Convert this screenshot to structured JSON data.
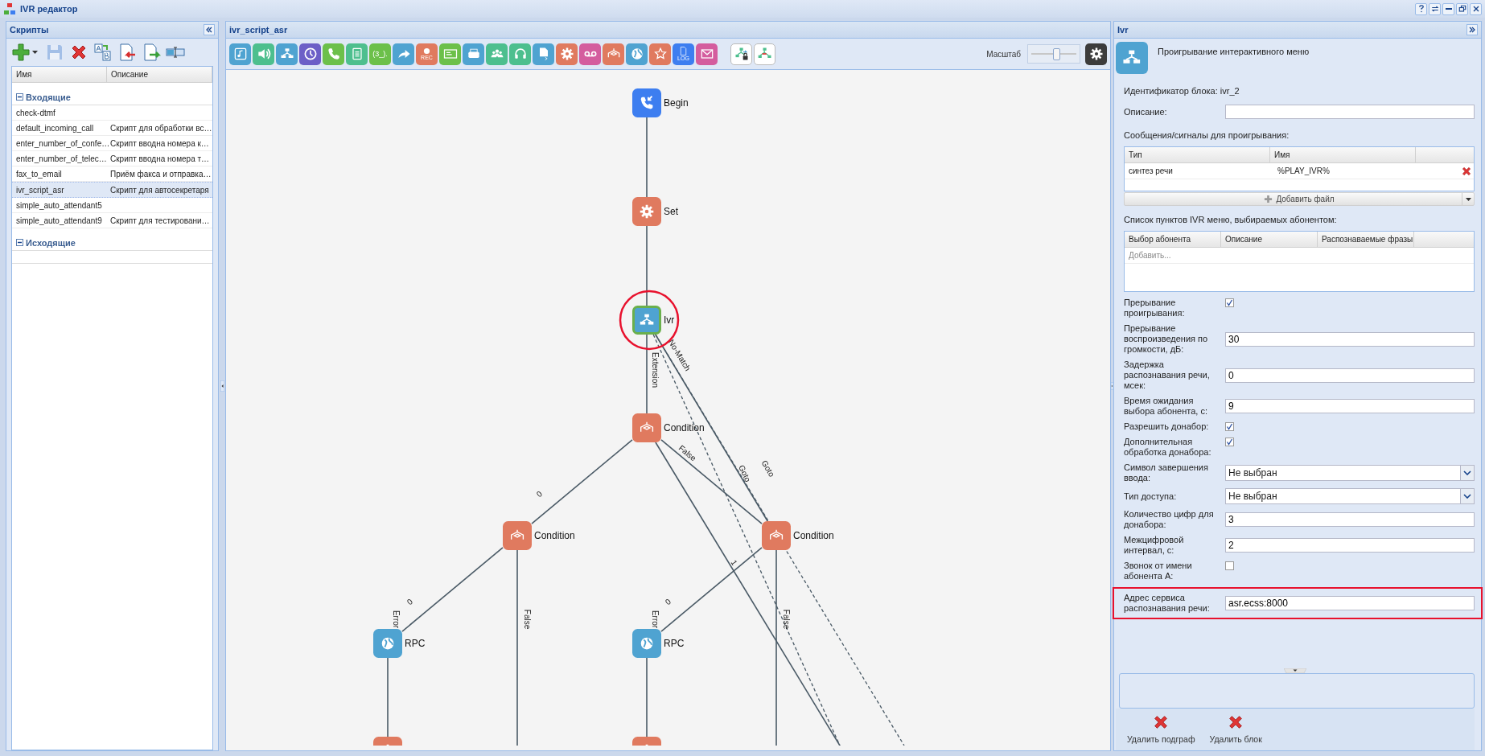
{
  "window": {
    "title": "IVR редактор",
    "controls": [
      {
        "kind": "help"
      },
      {
        "kind": "refresh"
      },
      {
        "kind": "minimize"
      },
      {
        "kind": "restore"
      },
      {
        "kind": "close"
      }
    ]
  },
  "scripts_panel": {
    "title": "Скрипты",
    "toolbar": [
      {
        "kind": "add",
        "disabled": false
      },
      {
        "kind": "save",
        "disabled": true
      },
      {
        "kind": "delete",
        "disabled": false
      },
      {
        "kind": "rename",
        "disabled": false
      },
      {
        "kind": "import",
        "disabled": false
      },
      {
        "kind": "export",
        "disabled": false
      },
      {
        "kind": "split",
        "disabled": false
      }
    ],
    "columns": [
      "Имя",
      "Описание"
    ],
    "groups": [
      {
        "label": "Входящие",
        "expanded": true,
        "rows": [
          {
            "name": "check-dtmf",
            "selected": false
          },
          {
            "name": "default_incoming_call",
            "description": "Скрипт для обработки вс…",
            "selected": false
          },
          {
            "name": "enter_number_of_confe…",
            "description": "Скрипт вводна номера к…",
            "selected": false
          },
          {
            "name": "enter_number_of_telec…",
            "description": "Скрипт вводна номера т…",
            "selected": false
          },
          {
            "name": "fax_to_email",
            "description": "Приём факса и отправка…",
            "selected": false
          },
          {
            "name": "ivr_script_asr",
            "description": "Скрипт для автосекретаря",
            "selected": true
          },
          {
            "name": "simple_auto_attendant5",
            "selected": false
          },
          {
            "name": "simple_auto_attendant9",
            "description": "Скрипт для тестировани…",
            "selected": false
          }
        ]
      },
      {
        "label": "Исходящие",
        "expanded": true
      }
    ]
  },
  "editor": {
    "title": "ivr_script_asr",
    "palette": [
      {
        "kind": "music",
        "color": "#4fa3d1"
      },
      {
        "kind": "speaker",
        "color": "#4dbf8e"
      },
      {
        "kind": "tree",
        "color": "#4fa3d1"
      },
      {
        "kind": "clock",
        "color": "#6c5fc7"
      },
      {
        "kind": "phone",
        "color": "#6cc04a"
      },
      {
        "kind": "list",
        "color": "#4dbf8e"
      },
      {
        "kind": "text",
        "color": "#6cc04a",
        "label": "(3_)."
      },
      {
        "kind": "forward",
        "color": "#4fa3d1"
      },
      {
        "kind": "rec",
        "color": "#e07a5f",
        "label": "REC"
      },
      {
        "kind": "card",
        "color": "#6cc04a"
      },
      {
        "kind": "fax",
        "color": "#4fa3d1"
      },
      {
        "kind": "people",
        "color": "#4dbf8e"
      },
      {
        "kind": "headset",
        "color": "#4dbf8e"
      },
      {
        "kind": "doccode",
        "color": "#4fa3d1"
      },
      {
        "kind": "gear",
        "color": "#e07a5f"
      },
      {
        "kind": "voicemail",
        "color": "#d45d9e"
      },
      {
        "kind": "condition",
        "color": "#e07a5f"
      },
      {
        "kind": "globe",
        "color": "#4fa3d1"
      },
      {
        "kind": "star",
        "color": "#e07a5f"
      },
      {
        "kind": "log",
        "color": "#3d7ef0",
        "label": "LOG"
      },
      {
        "kind": "mail",
        "color": "#d45d9e"
      },
      {
        "kind": "treelock",
        "color": "#ffffff"
      },
      {
        "kind": "treeswap",
        "color": "#ffffff"
      }
    ],
    "zoom": {
      "label": "Масштаб",
      "level": 0.55
    },
    "diagram": {
      "nodes": [
        {
          "kind": "start",
          "label": "Begin",
          "selected": false
        },
        {
          "kind": "set",
          "label": "Set",
          "selected": false
        },
        {
          "kind": "ivr",
          "label": "Ivr",
          "selected": true,
          "highlighted": true
        },
        {
          "kind": "condition",
          "label": "Condition",
          "selected": false
        },
        {
          "kind": "condition",
          "label": "Condition",
          "selected": false
        },
        {
          "kind": "condition",
          "label": "Condition",
          "selected": false
        },
        {
          "kind": "rpc",
          "label": "RPC",
          "selected": false
        },
        {
          "kind": "rpc",
          "label": "RPC",
          "selected": false
        },
        {
          "kind": "set",
          "selected": false
        },
        {
          "kind": "set",
          "selected": false
        }
      ],
      "edges": [
        {
          "dashed": false
        },
        {
          "dashed": false
        },
        {
          "label": "Extension",
          "dashed": false
        },
        {
          "label": "No-Match",
          "dashed": false
        },
        {
          "label": "Goto",
          "dashed": true
        },
        {
          "label": "Goto",
          "dashed": true
        },
        {
          "label": "0",
          "dashed": false
        },
        {
          "label": "False",
          "dashed": false
        },
        {
          "label": "1",
          "dashed": false
        },
        {
          "label": "0",
          "dashed": false
        },
        {
          "label": "False",
          "dashed": false
        },
        {
          "label": "0",
          "dashed": false
        },
        {
          "label": "False",
          "dashed": false
        },
        {
          "label": "Error",
          "dashed": false
        },
        {
          "label": "Error",
          "dashed": false
        }
      ]
    }
  },
  "block_panel": {
    "title": "Ivr",
    "heading": "Проигрывание интерактивного меню",
    "block_id": "Идентификатор блока: ivr_2",
    "description": {
      "label": "Описание:"
    },
    "messages": {
      "label": "Сообщения/сигналы для проигрывания:",
      "columns": [
        "Тип",
        "Имя"
      ],
      "rows": [
        {
          "type": "синтез речи",
          "name": "%PLAY_IVR%"
        }
      ],
      "add_button": "Добавить файл"
    },
    "menu_items": {
      "label": "Список пунктов IVR меню, выбираемых абонентом:",
      "columns": [
        "Выбор абонента",
        "Описание",
        "Распознаваемые фразы"
      ],
      "add_hint": "Добавить..."
    },
    "fields": [
      {
        "kind": "checkbox",
        "label": "Прерывание проигрывания:",
        "checked": true,
        "highlighted": false
      },
      {
        "kind": "text",
        "label": "Прерывание воспроизведения по громкости, дБ:",
        "value": "30",
        "highlighted": false
      },
      {
        "kind": "text",
        "label": "Задержка распознавания речи, мсек:",
        "value": "0",
        "highlighted": false
      },
      {
        "kind": "text",
        "label": "Время ожидания выбора абонента, с:",
        "value": "9",
        "highlighted": false
      },
      {
        "kind": "checkbox",
        "label": "Разрешить донабор:",
        "checked": true,
        "highlighted": false
      },
      {
        "kind": "checkbox",
        "label": "Дополнительная обработка донабора:",
        "checked": true,
        "highlighted": false
      },
      {
        "kind": "select",
        "label": "Символ завершения ввода:",
        "value": "Не выбран",
        "highlighted": false
      },
      {
        "kind": "select",
        "label": "Тип доступа:",
        "value": "Не выбран",
        "highlighted": false
      },
      {
        "kind": "text",
        "label": "Количество цифр для донабора:",
        "value": "3",
        "highlighted": false
      },
      {
        "kind": "text",
        "label": "Межцифровой интервал, с:",
        "value": "2",
        "highlighted": false
      },
      {
        "kind": "checkbox",
        "label": "Звонок от имени абонента А:",
        "checked": false,
        "highlighted": false
      },
      {
        "kind": "text",
        "label": "Адрес сервиса распознавания речи:",
        "value": "asr.ecss:8000",
        "highlighted": true
      }
    ],
    "actions": [
      "Удалить подграф",
      "Удалить блок"
    ]
  }
}
